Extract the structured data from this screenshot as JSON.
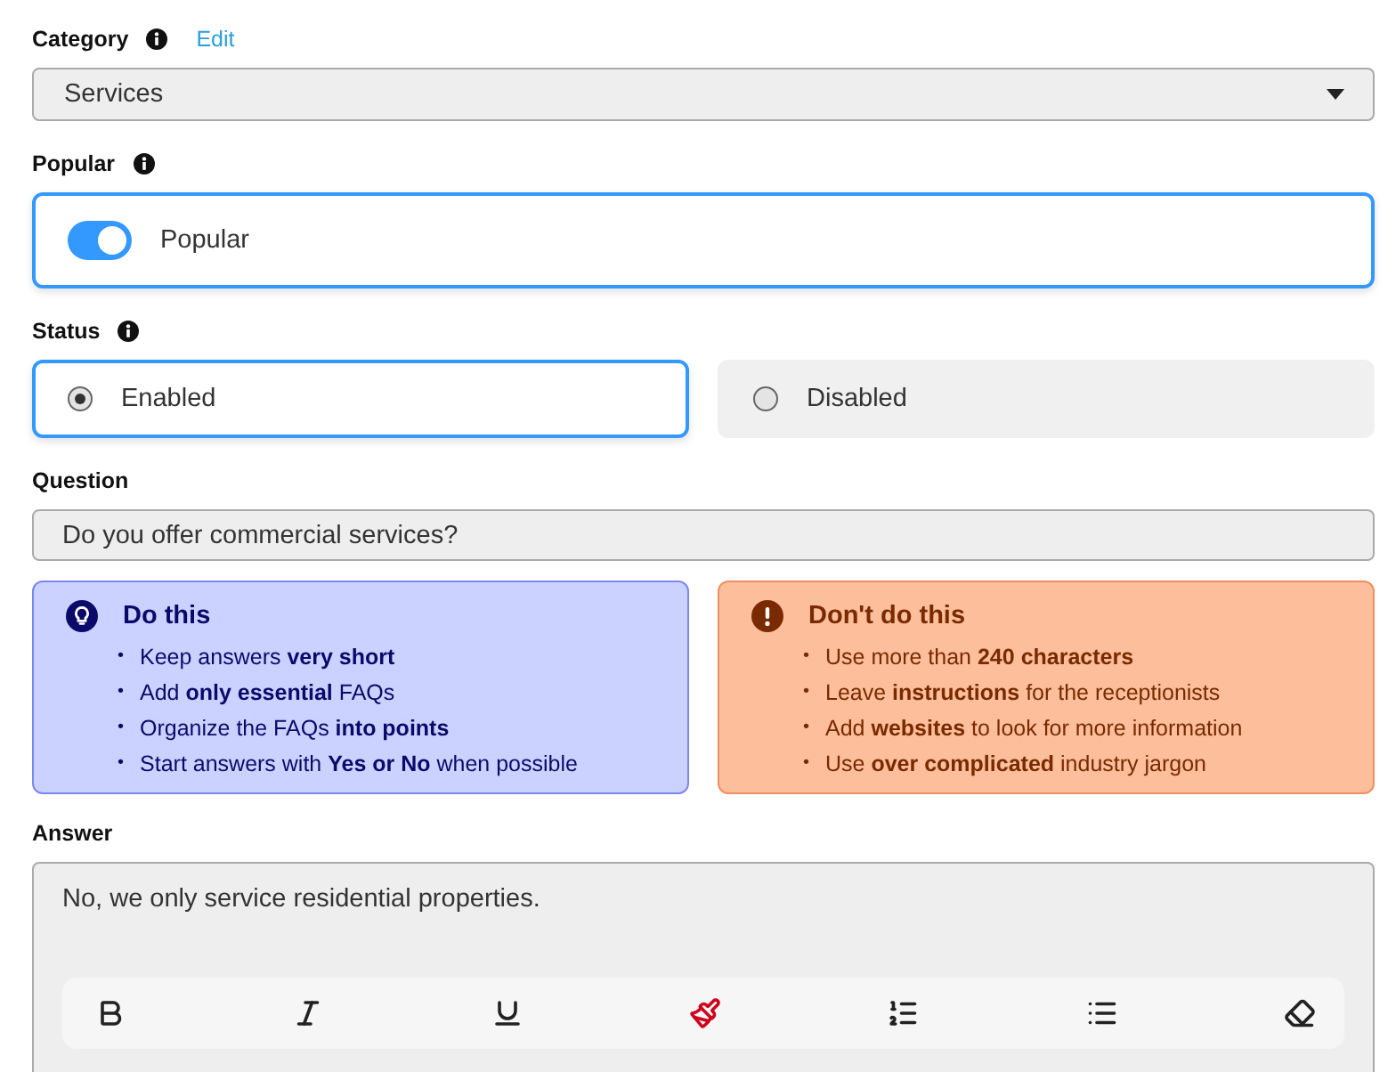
{
  "category": {
    "label": "Category",
    "edit_link": "Edit",
    "value": "Services"
  },
  "popular": {
    "label": "Popular",
    "toggle": {
      "label": "Popular",
      "on": true
    }
  },
  "status": {
    "label": "Status",
    "options": [
      {
        "label": "Enabled",
        "selected": true
      },
      {
        "label": "Disabled",
        "selected": false
      }
    ]
  },
  "question": {
    "label": "Question",
    "value": "Do you offer commercial services?"
  },
  "tips": [
    {
      "kind": "do",
      "title": "Do this",
      "bullet": "•",
      "items": [
        "Keep answers **very short**",
        "Add **only essential** FAQs",
        "Organize the FAQs **into points**",
        "Start answers with **Yes or No** when possible"
      ]
    },
    {
      "kind": "dont",
      "title": "Don't do this",
      "bullet": "•",
      "items": [
        "Use more than **240 characters**",
        "Leave **instructions** for the receptionists",
        "Add **websites** to look for more information",
        "Use **over complicated** industry jargon"
      ]
    }
  ],
  "answer": {
    "label": "Answer",
    "value": "No, we only service residential properties."
  }
}
